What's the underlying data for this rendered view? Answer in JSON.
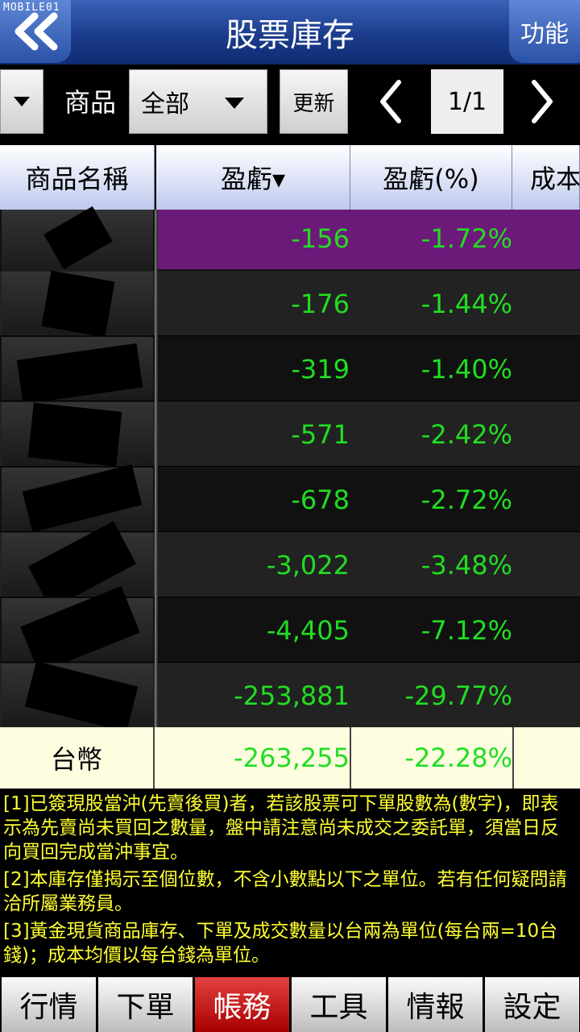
{
  "watermark": "MOBILE01",
  "header": {
    "title": "股票庫存",
    "function_label": "功能"
  },
  "toolbar": {
    "product_label": "商品",
    "product_value": "全部",
    "refresh_label": "更新",
    "page": "1/1"
  },
  "columns": [
    "商品名稱",
    "盈虧▾",
    "盈虧(%)",
    "成本"
  ],
  "rows": [
    {
      "pl": "-156",
      "pl_pct": "-1.72%"
    },
    {
      "pl": "-176",
      "pl_pct": "-1.44%"
    },
    {
      "pl": "-319",
      "pl_pct": "-1.40%"
    },
    {
      "pl": "-571",
      "pl_pct": "-2.42%"
    },
    {
      "pl": "-678",
      "pl_pct": "-2.72%"
    },
    {
      "pl": "-3,022",
      "pl_pct": "-3.48%"
    },
    {
      "pl": "-4,405",
      "pl_pct": "-7.12%"
    },
    {
      "pl": "-253,881",
      "pl_pct": "-29.77%"
    }
  ],
  "total": {
    "name": "台幣",
    "pl": "-263,255",
    "pl_pct": "-22.28%"
  },
  "notes": [
    "[1]已簽現股當沖(先賣後買)者，若該股票可下單股數為(數字)，即表示為先賣尚未買回之數量，盤中請注意尚未成交之委託單，須當日反向買回完成當沖事宜。",
    "[2]本庫存僅揭示至個位數，不含小數點以下之單位。若有任何疑問請洽所屬業務員。",
    "[3]黃金現貨商品庫存、下單及成交數量以台兩為單位(每台兩=10台錢)；成本均價以每台錢為單位。"
  ],
  "nav": [
    "行情",
    "下單",
    "帳務",
    "工具",
    "情報",
    "設定"
  ],
  "colors": {
    "header": "#1b3c8c",
    "gain_loss": "#22dd22",
    "selected_row": "#6b1a7a",
    "notes": "#ffff33",
    "active_nav": "#c41c1c",
    "total_row": "#fffde0"
  }
}
